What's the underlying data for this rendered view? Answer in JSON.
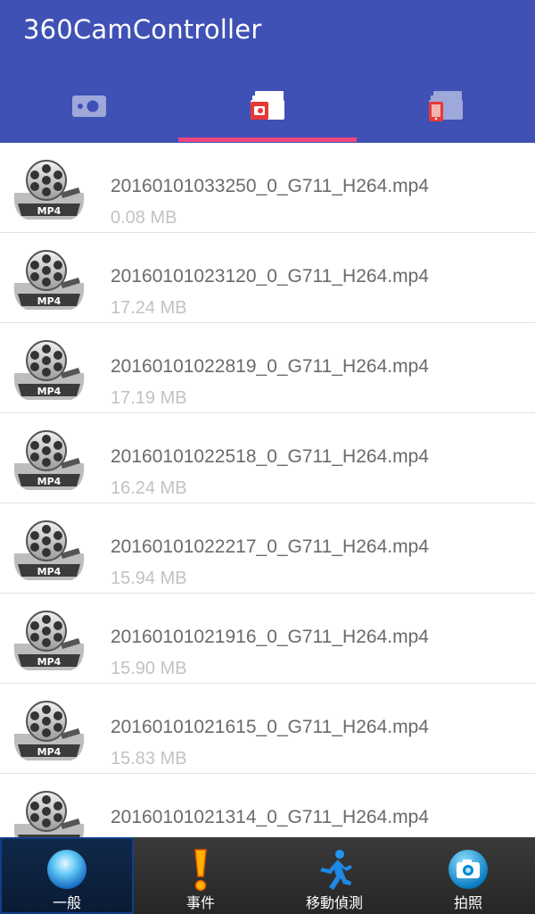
{
  "app": {
    "title": "360CamController"
  },
  "tabs": [
    {
      "name": "camera",
      "icon": "camera-icon"
    },
    {
      "name": "card-files",
      "icon": "sd-card-files-icon"
    },
    {
      "name": "phone-files",
      "icon": "phone-files-icon"
    }
  ],
  "files": [
    {
      "name": "20160101033250_0_G711_H264.mp4",
      "size": "0.08 MB"
    },
    {
      "name": "20160101023120_0_G711_H264.mp4",
      "size": "17.24 MB"
    },
    {
      "name": "20160101022819_0_G711_H264.mp4",
      "size": "17.19 MB"
    },
    {
      "name": "20160101022518_0_G711_H264.mp4",
      "size": "16.24 MB"
    },
    {
      "name": "20160101022217_0_G711_H264.mp4",
      "size": "15.94 MB"
    },
    {
      "name": "20160101021916_0_G711_H264.mp4",
      "size": "15.90 MB"
    },
    {
      "name": "20160101021615_0_G711_H264.mp4",
      "size": "15.83 MB"
    },
    {
      "name": "20160101021314_0_G711_H264.mp4",
      "size": ""
    }
  ],
  "thumb_badge": "MP4",
  "bottom_nav": [
    {
      "label": "一般",
      "icon": "blue-orb-icon"
    },
    {
      "label": "事件",
      "icon": "exclamation-icon"
    },
    {
      "label": "移動偵測",
      "icon": "running-man-icon"
    },
    {
      "label": "拍照",
      "icon": "camera-photo-icon"
    }
  ],
  "colors": {
    "primary": "#3f51b5",
    "accent": "#f0457f"
  }
}
